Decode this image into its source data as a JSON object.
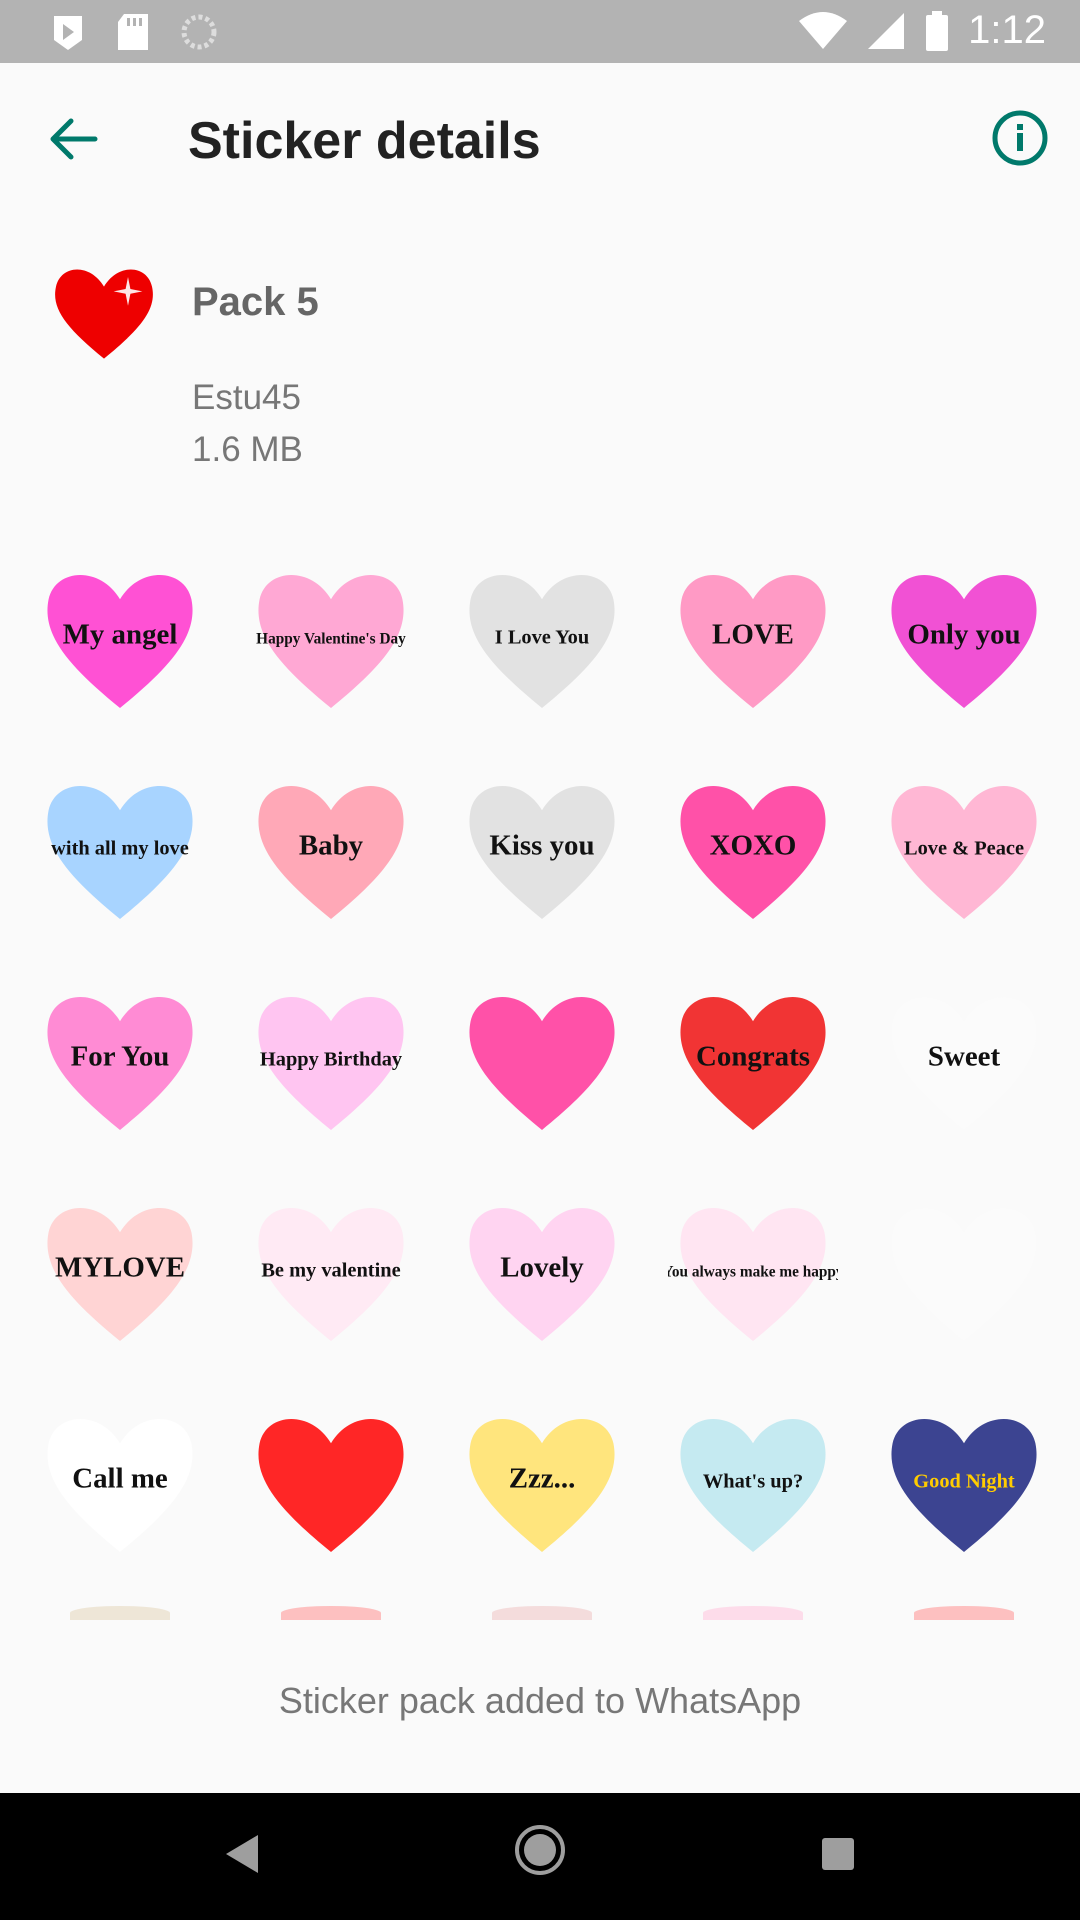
{
  "status_bar": {
    "time": "1:12",
    "icons": [
      "play-store-icon",
      "sd-card-icon",
      "sync-icon",
      "wifi-icon",
      "signal-icon",
      "battery-icon"
    ]
  },
  "app_bar": {
    "title": "Sticker details",
    "back_icon": "arrow-left-icon",
    "info_icon": "info-icon"
  },
  "pack": {
    "name": "Pack 5",
    "author": "Estu45",
    "size": "1.6 MB"
  },
  "stickers": [
    {
      "text": "My angel",
      "bg": "#ff33cc"
    },
    {
      "text": "Happy Valentine's Day",
      "bg": "#ff99cc"
    },
    {
      "text": "I Love You",
      "bg": "#dddddd"
    },
    {
      "text": "LOVE",
      "bg": "#ff88bb"
    },
    {
      "text": "Only you",
      "bg": "#ee33cc"
    },
    {
      "text": "with all my love",
      "bg": "#99ccff"
    },
    {
      "text": "Baby",
      "bg": "#ff99aa"
    },
    {
      "text": "Kiss you",
      "bg": "#dddddd"
    },
    {
      "text": "XOXO",
      "bg": "#ff3399"
    },
    {
      "text": "Love & Peace",
      "bg": "#ffaacc"
    },
    {
      "text": "For You",
      "bg": "#ff77cc"
    },
    {
      "text": "Happy Birthday",
      "bg": "#ffbbee"
    },
    {
      "text": "",
      "bg": "#ff3399"
    },
    {
      "text": "Congrats",
      "bg": "#ee1111"
    },
    {
      "text": "Sweet",
      "bg": "#fafafa"
    },
    {
      "text": "MYLOVE",
      "bg": "#ffcccc"
    },
    {
      "text": "Be my valentine",
      "bg": "#ffe6f2"
    },
    {
      "text": "Lovely",
      "bg": "#ffccee"
    },
    {
      "text": "You always make me happy",
      "bg": "#ffe0f0"
    },
    {
      "text": "",
      "bg": "#fafafa"
    },
    {
      "text": "Call me",
      "bg": "#ffffff"
    },
    {
      "text": "",
      "bg": "#ff0000"
    },
    {
      "text": "Zzz...",
      "bg": "#ffe066"
    },
    {
      "text": "What's up?",
      "bg": "#bbe6ee"
    },
    {
      "text": "Good Night",
      "bg": "#1a237e"
    }
  ],
  "footer": {
    "message": "Sticker pack added to WhatsApp"
  },
  "nav_bar": {
    "icons": [
      "back-triangle-icon",
      "home-circle-icon",
      "recents-square-icon"
    ]
  },
  "colors": {
    "accent": "#00796b",
    "heart_red": "#ee0000"
  }
}
